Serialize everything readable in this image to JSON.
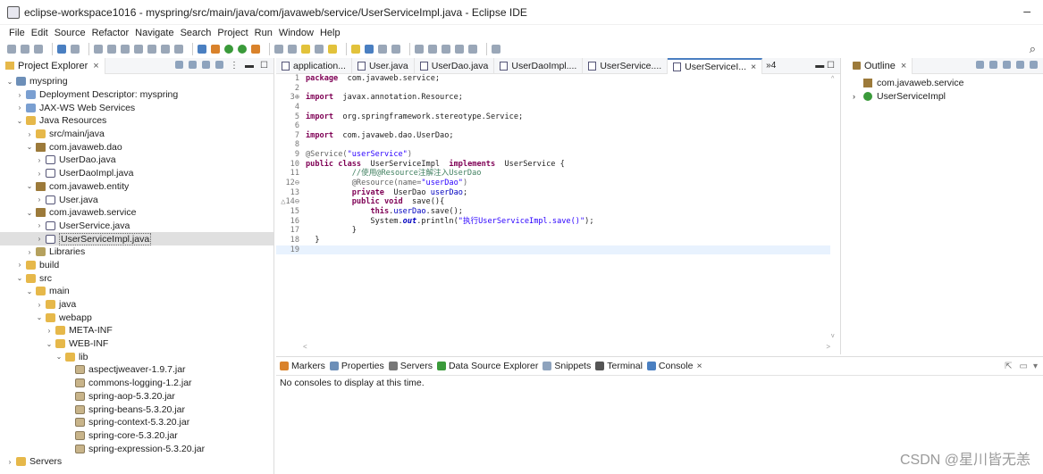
{
  "window": {
    "title": "eclipse-workspace1016 - myspring/src/main/java/com/javaweb/service/UserServiceImpl.java - Eclipse IDE",
    "minimize_label": "–"
  },
  "menu": [
    "File",
    "Edit",
    "Source",
    "Refactor",
    "Navigate",
    "Search",
    "Project",
    "Run",
    "Window",
    "Help"
  ],
  "explorer": {
    "tab_label": "Project Explorer",
    "close_label": "×",
    "tree": [
      {
        "label": "myspring",
        "arrow": "⌄",
        "icon": "project"
      },
      {
        "label": "Deployment Descriptor: myspring",
        "arrow": "›",
        "icon": "desc"
      },
      {
        "label": "JAX-WS Web Services",
        "arrow": "›",
        "icon": "desc"
      },
      {
        "label": "Java Resources",
        "arrow": "⌄",
        "icon": "folder"
      },
      {
        "label": "src/main/java",
        "arrow": "›",
        "icon": "folder"
      },
      {
        "label": "com.javaweb.dao",
        "arrow": "⌄",
        "icon": "package"
      },
      {
        "label": "UserDao.java",
        "arrow": "›",
        "icon": "java"
      },
      {
        "label": "UserDaoImpl.java",
        "arrow": "›",
        "icon": "java"
      },
      {
        "label": "com.javaweb.entity",
        "arrow": "⌄",
        "icon": "package"
      },
      {
        "label": "User.java",
        "arrow": "›",
        "icon": "java"
      },
      {
        "label": "com.javaweb.service",
        "arrow": "⌄",
        "icon": "package"
      },
      {
        "label": "UserService.java",
        "arrow": "›",
        "icon": "java"
      },
      {
        "label": "UserServiceImpl.java",
        "arrow": "›",
        "icon": "java"
      },
      {
        "label": "Libraries",
        "arrow": "›",
        "icon": "lib"
      },
      {
        "label": "build",
        "arrow": "›",
        "icon": "folder"
      },
      {
        "label": "src",
        "arrow": "⌄",
        "icon": "folder"
      },
      {
        "label": "main",
        "arrow": "⌄",
        "icon": "folder"
      },
      {
        "label": "java",
        "arrow": "›",
        "icon": "folder"
      },
      {
        "label": "webapp",
        "arrow": "⌄",
        "icon": "folder"
      },
      {
        "label": "META-INF",
        "arrow": "›",
        "icon": "folder"
      },
      {
        "label": "WEB-INF",
        "arrow": "⌄",
        "icon": "folder"
      },
      {
        "label": "lib",
        "arrow": "⌄",
        "icon": "folder"
      },
      {
        "label": "aspectjweaver-1.9.7.jar",
        "arrow": "",
        "icon": "jar"
      },
      {
        "label": "commons-logging-1.2.jar",
        "arrow": "",
        "icon": "jar"
      },
      {
        "label": "spring-aop-5.3.20.jar",
        "arrow": "",
        "icon": "jar"
      },
      {
        "label": "spring-beans-5.3.20.jar",
        "arrow": "",
        "icon": "jar"
      },
      {
        "label": "spring-context-5.3.20.jar",
        "arrow": "",
        "icon": "jar"
      },
      {
        "label": "spring-core-5.3.20.jar",
        "arrow": "",
        "icon": "jar"
      },
      {
        "label": "spring-expression-5.3.20.jar",
        "arrow": "",
        "icon": "jar"
      },
      {
        "label": "Servers",
        "arrow": "›",
        "icon": "folder"
      }
    ],
    "selected_label": "UserServiceImpl.java"
  },
  "editor": {
    "tabs": [
      {
        "label": "application...",
        "active": false
      },
      {
        "label": "User.java",
        "active": false
      },
      {
        "label": "UserDao.java",
        "active": false
      },
      {
        "label": "UserDaoImpl....",
        "active": false
      },
      {
        "label": "UserService....",
        "active": false
      },
      {
        "label": "UserServiceI...",
        "active": true
      }
    ],
    "overflow_label": "»4",
    "close_label": "×",
    "lines": [
      {
        "n": "1",
        "segs": [
          [
            "kw",
            "package"
          ],
          [
            "",
            "  com.javaweb.service;"
          ]
        ]
      },
      {
        "n": "2",
        "segs": []
      },
      {
        "n": "3⊕",
        "segs": [
          [
            "kw",
            "import"
          ],
          [
            "",
            "  javax.annotation.Resource;"
          ]
        ]
      },
      {
        "n": "4",
        "segs": []
      },
      {
        "n": "5",
        "segs": [
          [
            "kw",
            "import"
          ],
          [
            "",
            "  org.springframework.stereotype.Service;"
          ]
        ]
      },
      {
        "n": "6",
        "segs": []
      },
      {
        "n": "7",
        "segs": [
          [
            "kw",
            "import"
          ],
          [
            "",
            "  com.javaweb.dao.UserDao;"
          ]
        ]
      },
      {
        "n": "8",
        "segs": []
      },
      {
        "n": "9",
        "segs": [
          [
            "ann",
            "@Service("
          ],
          [
            "str",
            "\"userService\""
          ],
          [
            "ann",
            ")"
          ]
        ]
      },
      {
        "n": "10",
        "segs": [
          [
            "kw",
            "public class"
          ],
          [
            "",
            "  UserServiceImpl  "
          ],
          [
            "kw",
            "implements"
          ],
          [
            "",
            "  UserService {"
          ]
        ]
      },
      {
        "n": "11",
        "segs": [
          [
            "",
            "          "
          ],
          [
            "cm",
            "//使用@Resource注解注入UserDao"
          ]
        ]
      },
      {
        "n": "12⊖",
        "segs": [
          [
            "",
            "          "
          ],
          [
            "ann",
            "@Resource(name="
          ],
          [
            "str",
            "\"userDao\""
          ],
          [
            "ann",
            ")"
          ]
        ]
      },
      {
        "n": "13",
        "segs": [
          [
            "",
            "          "
          ],
          [
            "kw",
            "private"
          ],
          [
            "",
            "  UserDao "
          ],
          [
            "fld",
            "userDao"
          ],
          [
            "",
            ";"
          ]
        ]
      },
      {
        "n": "△14⊖",
        "segs": [
          [
            "",
            "          "
          ],
          [
            "kw",
            "public void"
          ],
          [
            "",
            "  save(){"
          ]
        ]
      },
      {
        "n": "15",
        "segs": [
          [
            "",
            "              "
          ],
          [
            "kw",
            "this"
          ],
          [
            "",
            "."
          ],
          [
            "fld",
            "userDao"
          ],
          [
            "",
            ".save();"
          ]
        ]
      },
      {
        "n": "16",
        "segs": [
          [
            "",
            "              System."
          ],
          [
            "ita",
            "out"
          ],
          [
            "",
            ".println("
          ],
          [
            "str",
            "\"执行UserServiceImpl.save()\""
          ],
          [
            "",
            ");"
          ]
        ]
      },
      {
        "n": "17",
        "segs": [
          [
            "",
            "          }"
          ]
        ]
      },
      {
        "n": "18",
        "segs": [
          [
            "",
            "  }"
          ]
        ]
      },
      {
        "n": "19",
        "segs": [],
        "current": true
      }
    ]
  },
  "outline": {
    "tab_label": "Outline",
    "close_label": "×",
    "items": [
      {
        "label": "com.javaweb.service",
        "icon": "pkg",
        "arrow": ""
      },
      {
        "label": "UserServiceImpl",
        "icon": "cls",
        "arrow": "›"
      }
    ]
  },
  "console": {
    "tabs": [
      {
        "label": "Markers",
        "icon_color": "#d9822b"
      },
      {
        "label": "Properties",
        "icon_color": "#6d8fb8"
      },
      {
        "label": "Servers",
        "icon_color": "#777777"
      },
      {
        "label": "Data Source Explorer",
        "icon_color": "#3a9a3a"
      },
      {
        "label": "Snippets",
        "icon_color": "#8ea3bd"
      },
      {
        "label": "Terminal",
        "icon_color": "#555555"
      },
      {
        "label": "Console",
        "icon_color": "#4a7fc1"
      }
    ],
    "close_label": "×",
    "message": "No consoles to display at this time."
  },
  "watermark": "CSDN @星川皆无恙"
}
